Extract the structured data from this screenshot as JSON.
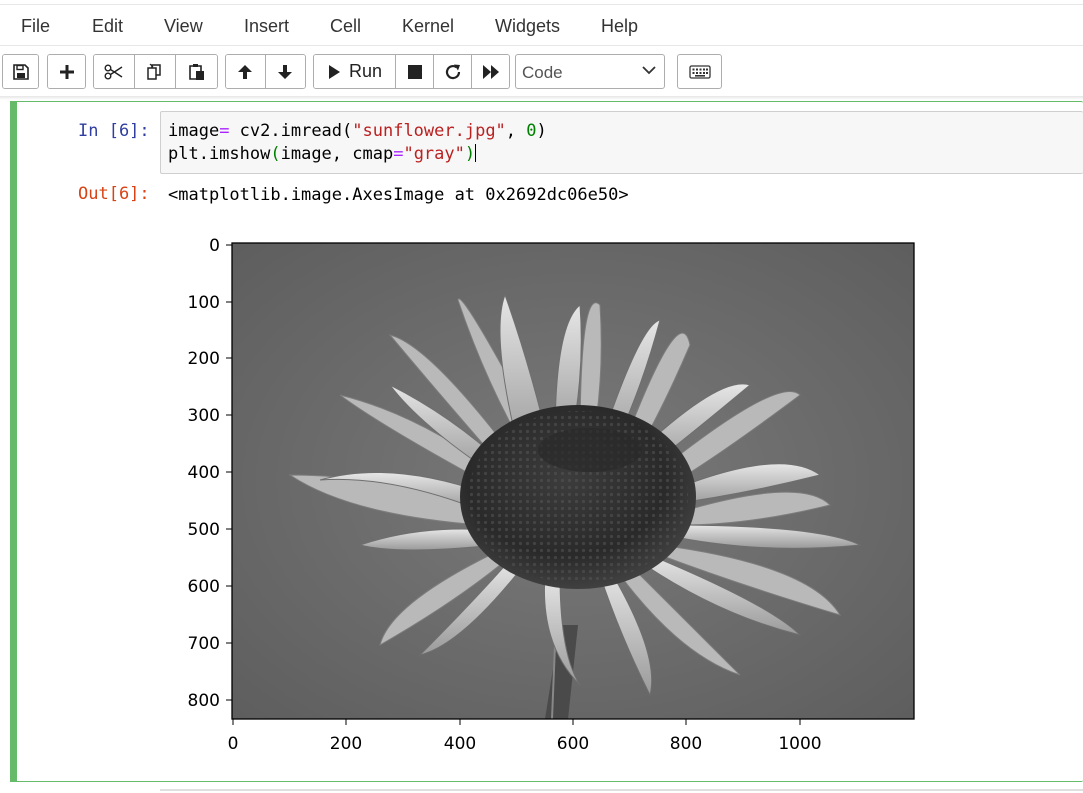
{
  "menubar": {
    "items": [
      "File",
      "Edit",
      "View",
      "Insert",
      "Cell",
      "Kernel",
      "Widgets",
      "Help"
    ]
  },
  "toolbar": {
    "save_icon": "save-icon",
    "add_icon": "plus-icon",
    "cut_icon": "scissors-icon",
    "copy_icon": "copy-icon",
    "paste_icon": "paste-icon",
    "move_up_icon": "arrow-up-icon",
    "move_down_icon": "arrow-down-icon",
    "run_label": "Run",
    "stop_icon": "stop-icon",
    "restart_icon": "restart-icon",
    "fast_forward_icon": "fast-forward-icon",
    "cell_type": "Code",
    "keyboard_icon": "keyboard-icon"
  },
  "cell": {
    "in_prompt": "In [6]:",
    "out_prompt": "Out[6]:",
    "code_line1": {
      "var": "image",
      "op": "=",
      "call": " cv2.imread(",
      "str": "\"sunflower.jpg\"",
      "sep": ", ",
      "num": "0",
      "close": ")"
    },
    "code_line2": {
      "call": "plt.imshow",
      "open": "(",
      "args": "image, cmap",
      "op": "=",
      "str": "\"gray\"",
      "close": ")"
    },
    "output_text": "<matplotlib.image.AxesImage at 0x2692dc06e50>"
  },
  "plot": {
    "y_ticks": [
      "0",
      "100",
      "200",
      "300",
      "400",
      "500",
      "600",
      "700",
      "800"
    ],
    "x_ticks": [
      "0",
      "200",
      "400",
      "600",
      "800",
      "1000"
    ],
    "image_subject": "grayscale sunflower"
  }
}
